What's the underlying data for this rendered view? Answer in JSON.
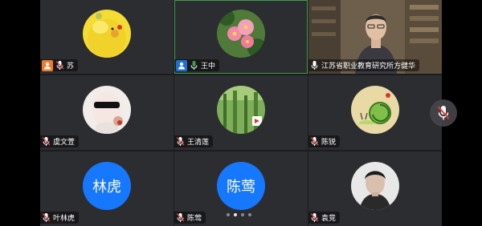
{
  "participants": [
    {
      "name": "苏",
      "badge": "host",
      "mic": "muted",
      "avatar": "chick-photo"
    },
    {
      "name": "王中",
      "badge": "cohost",
      "mic": "active",
      "avatar": "flower-photo",
      "active": true
    },
    {
      "name": "江苏省职业教育研究所方健华",
      "badge": "none",
      "mic": "active",
      "avatar": "video-feed"
    },
    {
      "name": "虞文萱",
      "badge": "none",
      "mic": "muted",
      "avatar": "sunglasses-photo"
    },
    {
      "name": "王清莲",
      "badge": "none",
      "mic": "muted",
      "avatar": "plants-photo"
    },
    {
      "name": "陈锐",
      "badge": "none",
      "mic": "muted",
      "avatar": "snail-drawing"
    },
    {
      "name": "叶林虎",
      "badge": "none",
      "mic": "muted",
      "avatar_text": "林虎"
    },
    {
      "name": "陈莺",
      "badge": "none",
      "mic": "muted",
      "avatar_text": "陈莺"
    },
    {
      "name": "袁竞",
      "badge": "none",
      "mic": "muted",
      "avatar": "man-portrait"
    }
  ],
  "pagination": {
    "pages": 4,
    "current": 2
  },
  "colors": {
    "accent_blue": "#1677ff",
    "host_orange": "#f17a2a",
    "muted_red": "#e53935",
    "active_green": "#3e9e4b"
  }
}
